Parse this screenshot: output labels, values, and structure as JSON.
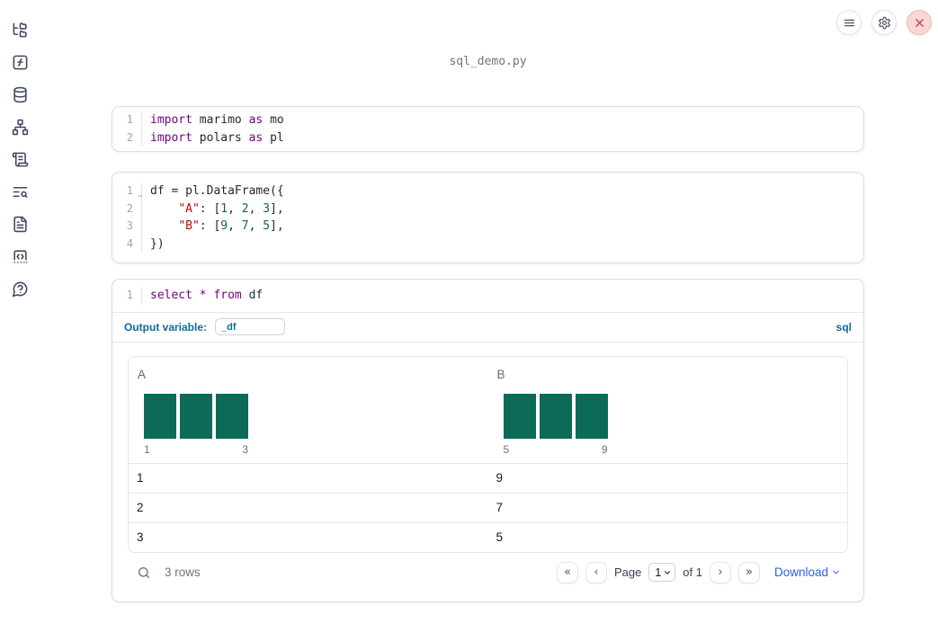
{
  "topbar": {
    "title": "sql_demo.py"
  },
  "sidebar": {
    "items": [
      "file-explorer",
      "variables",
      "data-sources",
      "dependency-graph",
      "logs",
      "tracebacks",
      "documentation",
      "snippets",
      "help"
    ]
  },
  "cells": {
    "imports": {
      "lines": [
        {
          "num": "1",
          "tokens": [
            "import",
            " marimo ",
            "as",
            " mo"
          ]
        },
        {
          "num": "2",
          "tokens": [
            "import",
            " polars ",
            "as",
            " pl"
          ]
        }
      ]
    },
    "dataframe": {
      "lines": [
        {
          "num": "1",
          "tokens": [
            "df = pl.DataFrame({"
          ]
        },
        {
          "num": "2",
          "tokens": [
            "    ",
            "\"A\"",
            ": [",
            "1",
            ", ",
            "2",
            ", ",
            "3",
            "],"
          ]
        },
        {
          "num": "3",
          "tokens": [
            "    ",
            "\"B\"",
            ": [",
            "9",
            ", ",
            "7",
            ", ",
            "5",
            "],"
          ]
        },
        {
          "num": "4",
          "tokens": [
            "})"
          ]
        }
      ]
    },
    "sql": {
      "lines": [
        {
          "num": "1",
          "tokens": [
            "select",
            " ",
            "*",
            " ",
            "from",
            " df"
          ]
        }
      ],
      "output_variable_label": "Output variable:",
      "output_variable_value": "_df",
      "language_badge": "sql"
    }
  },
  "table": {
    "columns": [
      {
        "name": "A",
        "hist": {
          "bars": [
            1,
            1,
            1
          ],
          "min_label": "1",
          "max_label": "3"
        }
      },
      {
        "name": "B",
        "hist": {
          "bars": [
            1,
            1,
            1
          ],
          "min_label": "5",
          "max_label": "9"
        }
      }
    ],
    "rows": [
      [
        "1",
        "9"
      ],
      [
        "2",
        "7"
      ],
      [
        "3",
        "5"
      ]
    ],
    "footer": {
      "row_count": "3 rows",
      "nav": {
        "first": "«",
        "prev": "‹",
        "next": "›",
        "last": "»"
      },
      "page_label": "Page",
      "page_value": "1",
      "of_label": "of 1",
      "download_label": "Download"
    }
  },
  "colors": {
    "accent_blue": "#0e6a9e",
    "link_blue": "#2563eb",
    "histogram_bar": "#0d6a59",
    "keyword": "#770088",
    "string": "#aa1111",
    "number": "#116644",
    "close_red": "#c63e3e"
  }
}
